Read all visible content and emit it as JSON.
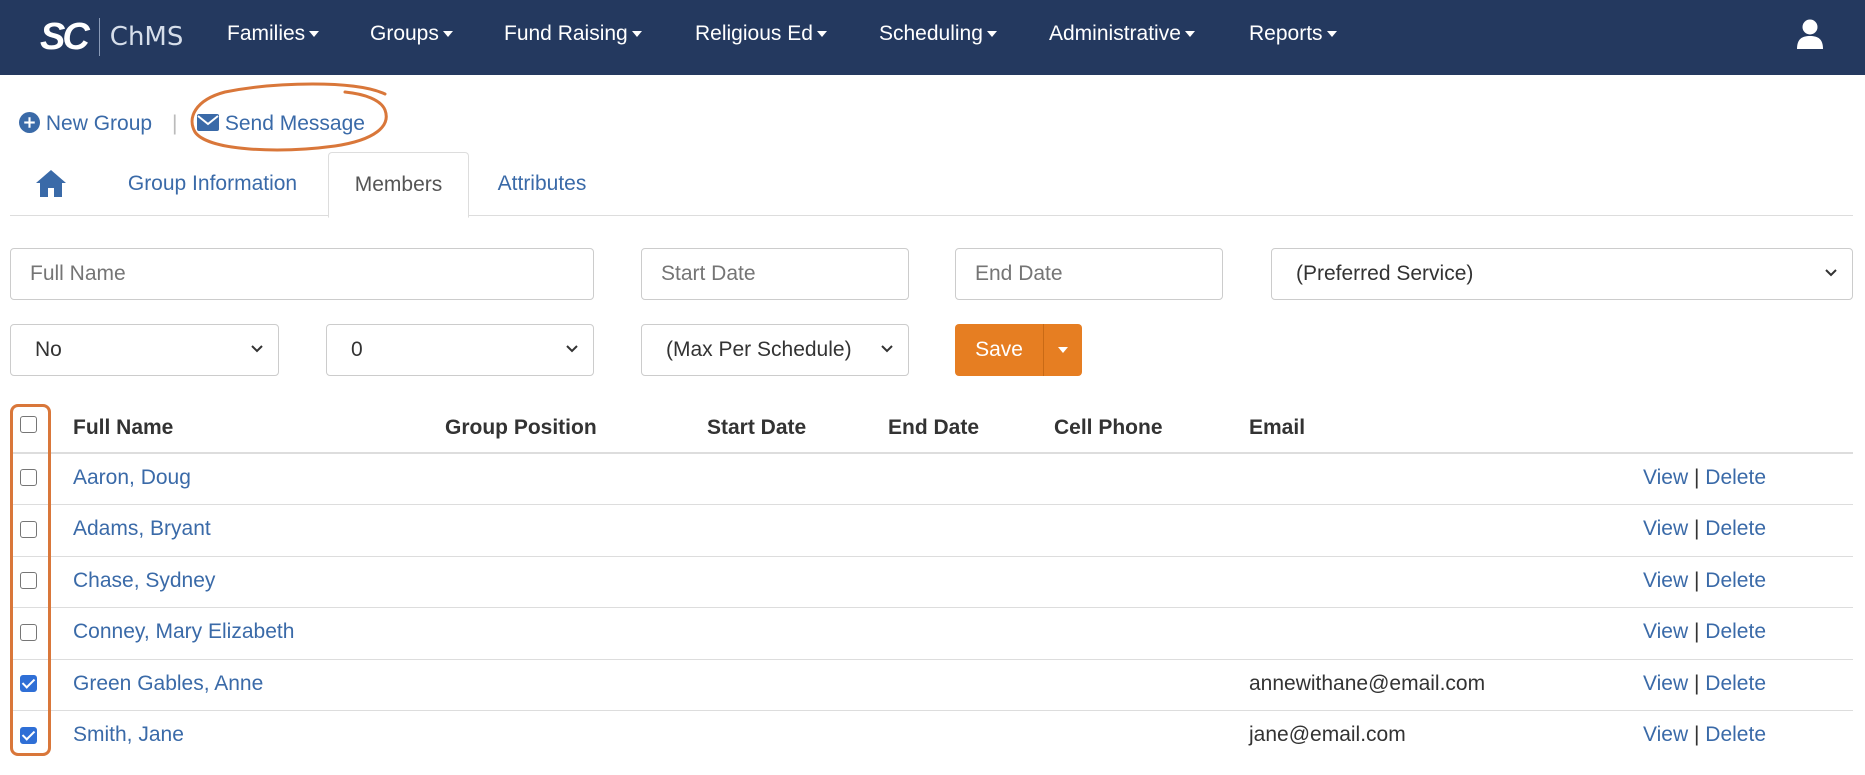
{
  "brand": {
    "logo_mark": "SC",
    "logo_text": "ChMS"
  },
  "nav": {
    "items": [
      "Families",
      "Groups",
      "Fund Raising",
      "Religious Ed",
      "Scheduling",
      "Administrative",
      "Reports"
    ]
  },
  "actions": {
    "new_group": "New Group",
    "send_message": "Send Message",
    "separator": "|"
  },
  "tabs": {
    "home": "home-icon",
    "items": [
      "Group Information",
      "Members",
      "Attributes"
    ],
    "active": "Members"
  },
  "filters": {
    "full_name_placeholder": "Full Name",
    "start_date_placeholder": "Start Date",
    "end_date_placeholder": "End Date",
    "preferred_service": "(Preferred Service)",
    "yes_no": "No",
    "count": "0",
    "max_per_schedule": "(Max Per Schedule)",
    "save_label": "Save"
  },
  "table": {
    "headers": [
      "Full Name",
      "Group Position",
      "Start Date",
      "End Date",
      "Cell Phone",
      "Email"
    ],
    "rows": [
      {
        "name": "Aaron, Doug",
        "email": "",
        "checked": false
      },
      {
        "name": "Adams, Bryant",
        "email": "",
        "checked": false
      },
      {
        "name": "Chase, Sydney",
        "email": "",
        "checked": false
      },
      {
        "name": "Conney, Mary Elizabeth",
        "email": "",
        "checked": false
      },
      {
        "name": "Green Gables, Anne",
        "email": "annewithane@email.com",
        "checked": true
      },
      {
        "name": "Smith, Jane",
        "email": "jane@email.com",
        "checked": true
      }
    ],
    "view_label": "View",
    "delete_label": "Delete",
    "action_sep": "|"
  },
  "colors": {
    "navbar": "#24395f",
    "link": "#3a6aa8",
    "accent": "#e67e22",
    "annotation": "#d9773a"
  }
}
